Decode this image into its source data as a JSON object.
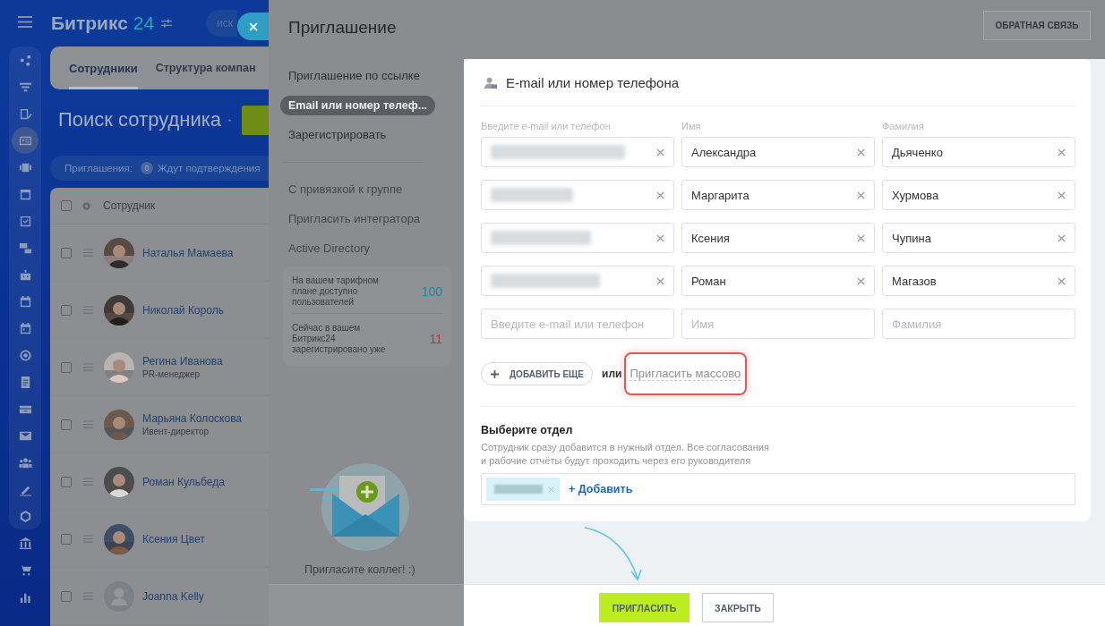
{
  "app": {
    "logo": {
      "name": "Битрикс",
      "number": "24"
    },
    "search": {
      "placeholder": "иск"
    },
    "sidebar": {
      "items": [
        {
          "selected": false
        },
        {
          "selected": false
        },
        {
          "selected": false
        },
        {
          "selected": true
        },
        {
          "selected": false
        },
        {
          "selected": false
        },
        {
          "selected": false
        },
        {
          "selected": false
        },
        {
          "selected": false
        },
        {
          "selected": false
        },
        {
          "selected": false
        },
        {
          "selected": false
        },
        {
          "selected": false
        },
        {
          "selected": false
        },
        {
          "selected": false
        },
        {
          "selected": false
        },
        {
          "selected": false
        },
        {
          "selected": false
        },
        {
          "selected": false
        },
        {
          "selected": false
        },
        {
          "selected": false
        }
      ]
    },
    "tabs": [
      {
        "label": "Сотрудники",
        "selected": true
      },
      {
        "label": "Структура компан",
        "selected": false
      }
    ],
    "page_title": "Поиск сотрудника",
    "invites": {
      "label": "Приглашения:",
      "count": "0",
      "status": "Ждут подтверждения"
    },
    "table": {
      "column": "Сотрудник",
      "all_checked": false,
      "rows": [
        {
          "name": "Наталья Мамаева",
          "checked": false
        },
        {
          "name": "Николай Король",
          "checked": false
        },
        {
          "name": "Регина Иванова",
          "position": "PR-менеджер",
          "checked": false
        },
        {
          "name": "Марьяна Колоскова",
          "position": "Ивент-директор",
          "checked": false
        },
        {
          "name": "Роман Кульбеда",
          "checked": false
        },
        {
          "name": "Ксения Цвет",
          "checked": false
        },
        {
          "name": "Joanna Kelly",
          "kind": "placeholder",
          "checked": false
        }
      ]
    }
  },
  "slider": {
    "title": "Приглашение",
    "feedback_button": "ОБРАТНАЯ СВЯЗЬ",
    "nav": {
      "items": [
        {
          "label": "Приглашение по ссылке",
          "selected": false
        },
        {
          "label": "Email или номер телеф...",
          "selected": true
        },
        {
          "label": "Зарегистрировать",
          "selected": false
        }
      ],
      "extra_items": [
        {
          "label": "С привязкой к группе"
        },
        {
          "label": "Пригласить интегратора"
        },
        {
          "label": "Active Directory"
        }
      ],
      "stats": [
        {
          "text": "На вашем тарифном плане доступно пользователей",
          "value": "100",
          "kind": "limit"
        },
        {
          "text": "Сейчас в вашем Битрикс24 зарегистрировано уже",
          "value": "11",
          "kind": "used"
        }
      ],
      "illustration_caption": "Пригласите коллег! :)"
    },
    "form": {
      "title": "E-mail или номер телефона",
      "labels": [
        "Введите e-mail или телефон",
        "Имя",
        "Фамилия"
      ],
      "rows": [
        {
          "email_hidden": true,
          "first_name": "Александра",
          "last_name": "Дьяченко"
        },
        {
          "email_hidden": true,
          "first_name": "Маргарита",
          "last_name": "Хурмова"
        },
        {
          "email_hidden": true,
          "first_name": "Ксения",
          "last_name": "Чупина"
        },
        {
          "email_hidden": true,
          "first_name": "Роман",
          "last_name": "Магазов"
        }
      ],
      "empty_row": {
        "email_placeholder": "Введите e-mail или телефон",
        "first_name_placeholder": "Имя",
        "last_name_placeholder": "Фамилия"
      },
      "add_more_button": "ДОБАВИТЬ ЕЩЕ",
      "or": "или",
      "mass_invite_link": "Пригласить массово",
      "department": {
        "title": "Выберите отдел",
        "description": "Сотрудник сразу добавится в нужный отдел. Все согласования и рабочие отчёты будут проходить через его руководителя",
        "tag_hidden": true,
        "add_link": "+ Добавить"
      }
    },
    "buttons": {
      "invite": "ПРИГЛАСИТЬ",
      "close": "ЗАКРЫТЬ"
    }
  }
}
